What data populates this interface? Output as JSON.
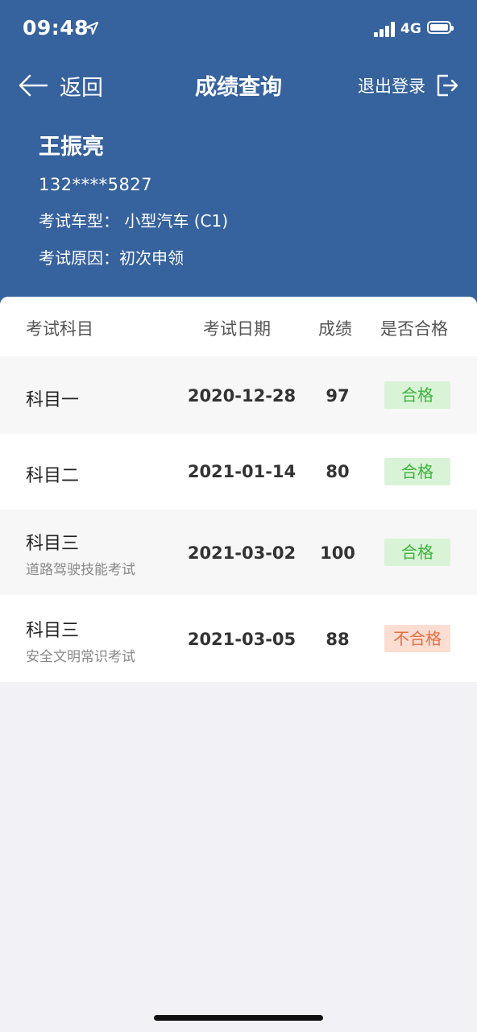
{
  "status_bar": {
    "time": "09:48",
    "network": "4G"
  },
  "nav": {
    "back_label": "返回",
    "title": "成绩查询",
    "logout_label": "退出登录"
  },
  "profile": {
    "name": "王振亮",
    "phone": "132****5827",
    "vehicle_type": "考试车型： 小型汽车 (C1)",
    "exam_reason": "考试原因：初次申领"
  },
  "table": {
    "headers": {
      "subject": "考试科目",
      "date": "考试日期",
      "score": "成绩",
      "passed": "是否合格"
    },
    "rows": [
      {
        "subject": "科目一",
        "sub": "",
        "date": "2020-12-28",
        "score": "97",
        "result": "合格"
      },
      {
        "subject": "科目二",
        "sub": "",
        "date": "2021-01-14",
        "score": "80",
        "result": "合格"
      },
      {
        "subject": "科目三",
        "sub": "道路驾驶技能考试",
        "date": "2021-03-02",
        "score": "100",
        "result": "合格"
      },
      {
        "subject": "科目三",
        "sub": "安全文明常识考试",
        "date": "2021-03-05",
        "score": "88",
        "result": "不合格"
      }
    ]
  },
  "colors": {
    "header_bg": "#36629d",
    "pass": "#3cb33c",
    "fail": "#e86e3f",
    "page_bg": "#f1f1f6"
  },
  "icons": {
    "back": "arrow-left-icon",
    "logout": "logout-icon",
    "location": "location-arrow-icon",
    "signal": "signal-icon",
    "battery": "battery-icon"
  }
}
